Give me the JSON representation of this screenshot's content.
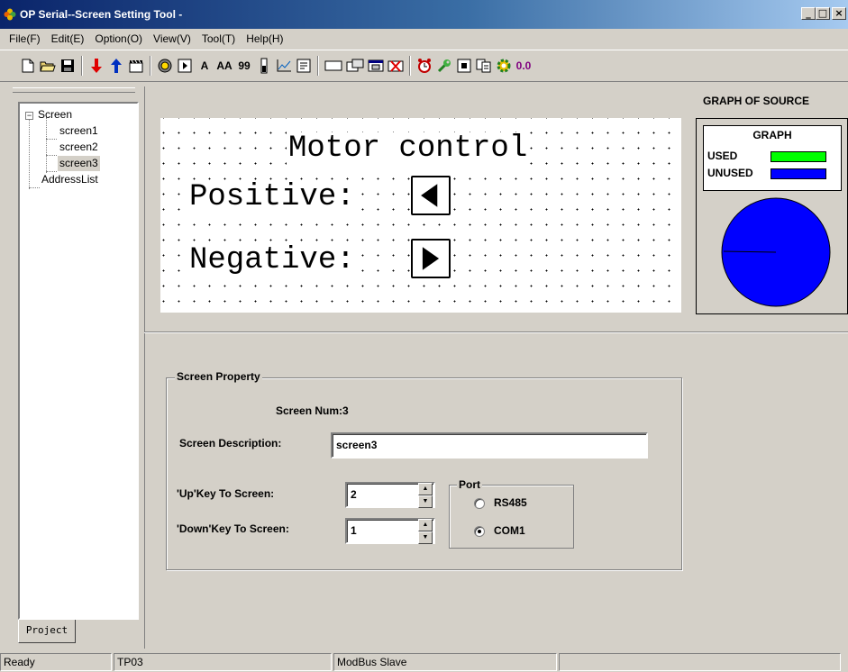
{
  "window": {
    "title": "OP Serial--Screen Setting Tool -"
  },
  "menu": [
    "File(F)",
    "Edit(E)",
    "Option(O)",
    "View(V)",
    "Tool(T)",
    "Help(H)"
  ],
  "toolbar": {
    "text_a": "A",
    "text_aa": "AA",
    "text_99": "99",
    "zoom": "0.0"
  },
  "tree": {
    "root": "Screen",
    "children": [
      "screen1",
      "screen2",
      "screen3"
    ],
    "selected": "screen3",
    "other": "AddressList",
    "expander": "−"
  },
  "tabs": {
    "project": "Project"
  },
  "canvas": {
    "title": "Motor control",
    "positive": "Positive:",
    "negative": "Negative:"
  },
  "graph": {
    "header": "GRAPH OF SOURCE",
    "box_title": "GRAPH",
    "used_label": "USED",
    "unused_label": "UNUSED",
    "used_color": "#00ff00",
    "unused_color": "#0000ff"
  },
  "screen_property": {
    "group_title": "Screen Property",
    "screen_num": "Screen Num:3",
    "description_label": "Screen Description:",
    "description_value": "screen3",
    "up_key_label": "'Up'Key To Screen:",
    "up_key_value": "2",
    "down_key_label": "'Down'Key To Screen:",
    "down_key_value": "1",
    "port": {
      "title": "Port",
      "options": [
        "RS485",
        "COM1"
      ],
      "selected": "COM1"
    }
  },
  "status": [
    "Ready",
    "TP03",
    "ModBus Slave"
  ]
}
